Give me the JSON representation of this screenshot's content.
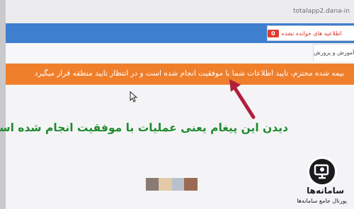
{
  "browser": {
    "url": "totalapp2.dana-in"
  },
  "header": {
    "notification": {
      "count": "0",
      "label": "اطلاعیه های خوانده نشده"
    },
    "tab_label": "آموزش و پرورش"
  },
  "alert": {
    "text": "بیمه شده محترم، تایید اطلاعات شما با موفقیت انجام شده است و در انتظار تایید منطقه قرار میگیرد"
  },
  "annotation": {
    "caption": "دیدن این پیغام یعنی عملیات با موفقیت انجام شده است"
  },
  "swatches": [
    "#8a7a74",
    "#e3c9a6",
    "#b8c0cc",
    "#9a6a52"
  ],
  "logo": {
    "title": "سامانه‌ها",
    "subtitle": "پورتال جامع سامانه‌ها"
  },
  "colors": {
    "topbar_blue": "#3f7fcf",
    "alert_orange": "#f07f2c",
    "caption_green": "#1f8a2e",
    "arrow_red": "#b01f3b"
  }
}
